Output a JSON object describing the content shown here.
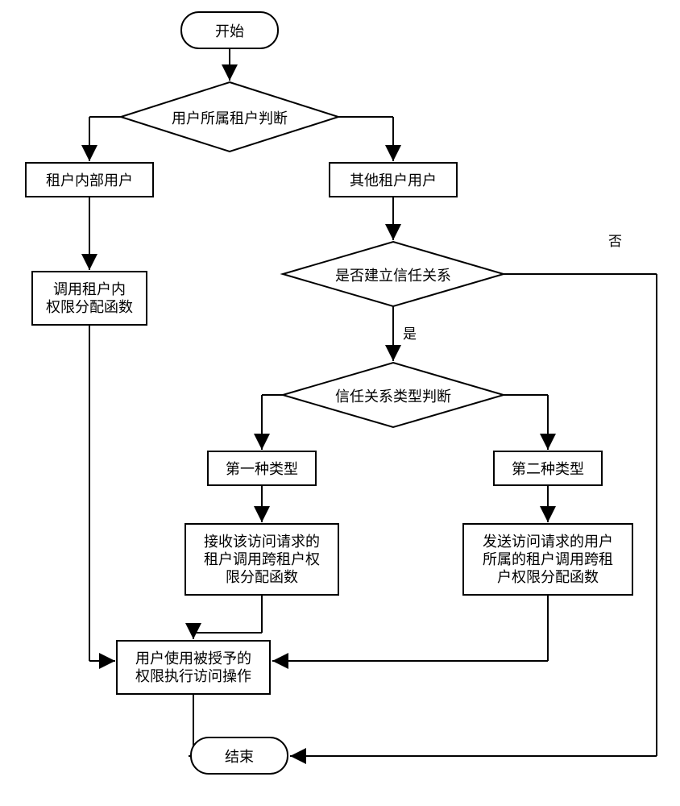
{
  "chart_data": {
    "type": "flowchart",
    "nodes": {
      "start": "开始",
      "d1": "用户所属租户判断",
      "n1": "租户内部用户",
      "n2": "其他租户用户",
      "n3l1": "调用租户内",
      "n3l2": "权限分配函数",
      "d2": "是否建立信任关系",
      "d3": "信任关系类型判断",
      "n4": "第一种类型",
      "n5": "第二种类型",
      "n6l1": "接收该访问请求的",
      "n6l2": "租户调用跨租户权",
      "n6l3": "限分配函数",
      "n7l1": "发送访问请求的用户",
      "n7l2": "所属的租户调用跨租",
      "n7l3": "户权限分配函数",
      "n8l1": "用户使用被授予的",
      "n8l2": "权限执行访问操作",
      "end": "结束"
    },
    "edges": {
      "yes": "是",
      "no": "否"
    }
  }
}
